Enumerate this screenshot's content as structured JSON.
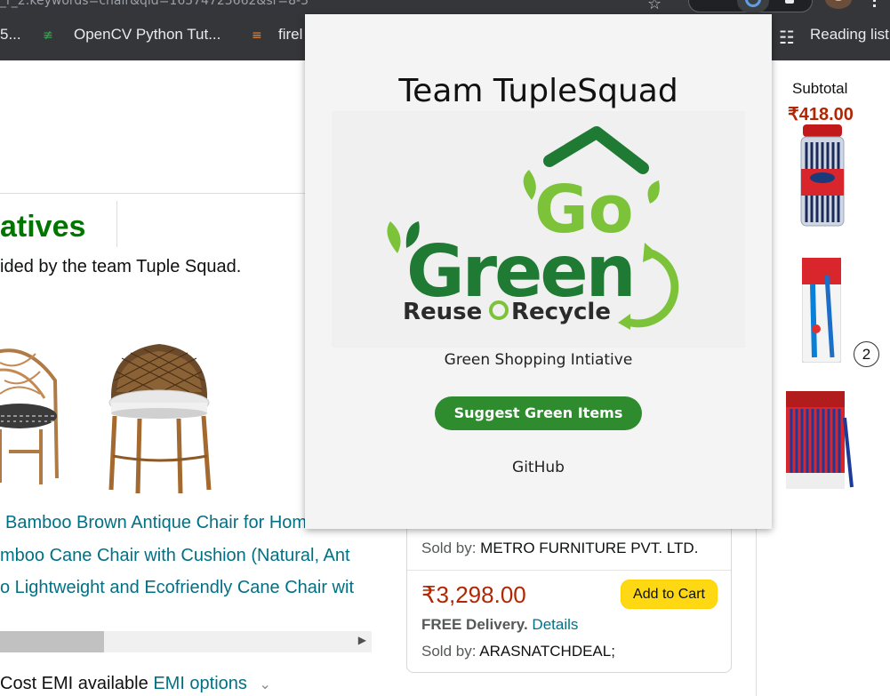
{
  "browser": {
    "address_fragment": "_r_2:keywords=chair&qid=16574725662&sr=8-3",
    "bookmarks": [
      {
        "label": "5..."
      },
      {
        "label": "OpenCV Python Tut..."
      },
      {
        "label": "firel"
      },
      {
        "label": "Reading list"
      }
    ]
  },
  "page": {
    "heading": "atives",
    "subtext": "ided by the team Tuple Squad.",
    "product_links": [
      "Bamboo Brown Antique Chair for Home D",
      "mboo Cane Chair with Cushion (Natural, Ant",
      "o Lightweight and Ecofriendly Cane Chair wit"
    ],
    "emi_text": "Cost EMI available",
    "emi_link": "EMI options",
    "offer": {
      "sold_by_label": "Sold by:",
      "sold_by_1": "METRO FURNITURE PVT. LTD.",
      "price": "₹3,298.00",
      "add_to_cart": "Add to Cart",
      "delivery_bold": "FREE Delivery.",
      "delivery_link": "Details",
      "sold_by_2": "ARASNATCHDEAL;"
    },
    "cart": {
      "subtotal_label": "Subtotal",
      "subtotal_amount": "₹418.00",
      "qty": "2"
    }
  },
  "popup": {
    "title": "Team TupleSquad",
    "logo": {
      "line1": "Go",
      "line2": "Green",
      "line3_a": "Reuse",
      "line3_b": "Recycle"
    },
    "caption": "Green Shopping Intiative",
    "button": "Suggest Green Items",
    "github": "GitHub"
  },
  "colors": {
    "chrome": "#35363a",
    "heading_green": "#007600",
    "link_teal": "#007185",
    "price_red": "#b12704",
    "cart_yellow": "#ffd814",
    "popup_button": "#2e8b2e"
  }
}
